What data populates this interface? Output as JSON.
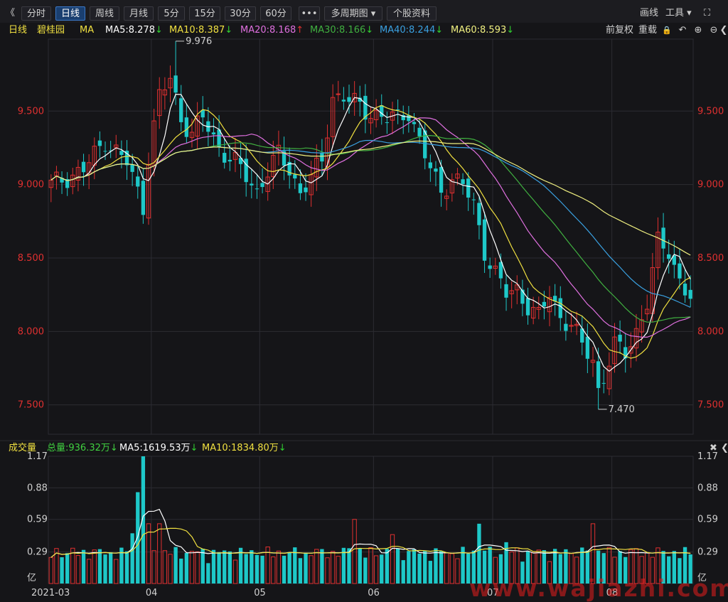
{
  "toolbar": {
    "collapse_icon": "double-chevron-left-icon",
    "collapse_glyph": "《",
    "buttons": [
      {
        "label": "分时",
        "active": false
      },
      {
        "label": "日线",
        "active": true
      },
      {
        "label": "周线",
        "active": false
      },
      {
        "label": "月线",
        "active": false
      },
      {
        "label": "5分",
        "active": false
      },
      {
        "label": "15分",
        "active": false
      },
      {
        "label": "30分",
        "active": false
      },
      {
        "label": "60分",
        "active": false
      }
    ],
    "more_label": "•••",
    "multi_period_label": "多周期图 ▾",
    "stock_info_label": "个股资料",
    "draw_label": "画线",
    "tools_label": "工具 ▾",
    "fullscreen_glyph": "⛶"
  },
  "legend": {
    "period": "日线",
    "stock_name": "碧桂园",
    "indicator": "MA",
    "items": [
      {
        "text": "MA5:8.278",
        "arrow": "↓",
        "color": "#ffffff"
      },
      {
        "text": "MA10:8.387",
        "arrow": "↓",
        "color": "#f0e040"
      },
      {
        "text": "MA20:8.168",
        "arrow": "↑",
        "color": "#e070e0"
      },
      {
        "text": "MA30:8.166",
        "arrow": "↓",
        "color": "#40b040"
      },
      {
        "text": "MA40:8.244",
        "arrow": "↓",
        "color": "#3aa0e0"
      },
      {
        "text": "MA60:8.593",
        "arrow": "↓",
        "color": "#f0f080"
      }
    ],
    "adjust_label": "前复权",
    "reload_label": "重载",
    "lock_glyph": "🔒",
    "undo_glyph": "↶",
    "zoom_in_glyph": "⊕",
    "zoom_out_glyph": "⊖",
    "expand_glyph": "❮"
  },
  "colors": {
    "up": "#e03030",
    "down": "#1ec8c8",
    "grid": "#2c2c32",
    "price_axis": "#e03030",
    "bg": "#151518"
  },
  "price_axis": {
    "ticks": [
      "9.500",
      "9.000",
      "8.500",
      "8.000",
      "7.500"
    ],
    "values": [
      9.5,
      9.0,
      8.5,
      8.0,
      7.5
    ],
    "max_label": "9.976",
    "min_label": "7.470"
  },
  "volume": {
    "title": "成交量",
    "total_label": "总量:936.32万",
    "total_arrow": "↓",
    "ma5_label": "MA5:1619.53万",
    "ma5_arrow": "↓",
    "ma10_label": "MA10:1834.80万",
    "ma10_arrow": "↓",
    "axis_ticks": [
      "1.17",
      "0.88",
      "0.59",
      "0.29",
      "亿"
    ],
    "close_glyph": "✖",
    "expand_glyph": "❮"
  },
  "x_axis": {
    "labels": [
      "2021-03",
      "04",
      "05",
      "06",
      "07",
      "08"
    ]
  },
  "watermark": "www.wajiazhi.com",
  "chart_data": {
    "type": "candlestick",
    "start_index_label": "2021-03",
    "month_starts": [
      {
        "label": "04",
        "index": 19
      },
      {
        "label": "05",
        "index": 39
      },
      {
        "label": "06",
        "index": 60
      },
      {
        "label": "07",
        "index": 82
      },
      {
        "label": "08",
        "index": 104
      }
    ],
    "close_anchors": [
      [
        0,
        9.0
      ],
      [
        6,
        9.1
      ],
      [
        10,
        9.3
      ],
      [
        14,
        9.15
      ],
      [
        17,
        8.85
      ],
      [
        18,
        9.2
      ],
      [
        20,
        9.6
      ],
      [
        22,
        9.72
      ],
      [
        24,
        9.45
      ],
      [
        26,
        9.35
      ],
      [
        28,
        9.45
      ],
      [
        31,
        9.25
      ],
      [
        34,
        9.15
      ],
      [
        36,
        9.05
      ],
      [
        38,
        8.95
      ],
      [
        40,
        9.1
      ],
      [
        42,
        9.2
      ],
      [
        44,
        9.1
      ],
      [
        46,
        8.95
      ],
      [
        48,
        9.05
      ],
      [
        50,
        9.15
      ],
      [
        52,
        9.6
      ],
      [
        54,
        9.6
      ],
      [
        56,
        9.55
      ],
      [
        58,
        9.5
      ],
      [
        60,
        9.48
      ],
      [
        62,
        9.45
      ],
      [
        64,
        9.45
      ],
      [
        66,
        9.5
      ],
      [
        68,
        9.3
      ],
      [
        70,
        9.1
      ],
      [
        72,
        8.95
      ],
      [
        74,
        9.05
      ],
      [
        76,
        9.0
      ],
      [
        78,
        8.85
      ],
      [
        80,
        8.55
      ],
      [
        82,
        8.4
      ],
      [
        84,
        8.25
      ],
      [
        86,
        8.28
      ],
      [
        88,
        8.18
      ],
      [
        90,
        8.1
      ],
      [
        92,
        8.25
      ],
      [
        94,
        8.1
      ],
      [
        96,
        8.05
      ],
      [
        98,
        7.9
      ],
      [
        100,
        7.8
      ],
      [
        101,
        7.6
      ],
      [
        102,
        7.7
      ],
      [
        104,
        7.9
      ],
      [
        106,
        7.85
      ],
      [
        108,
        8.0
      ],
      [
        110,
        8.2
      ],
      [
        112,
        8.6
      ],
      [
        114,
        8.55
      ],
      [
        116,
        8.35
      ],
      [
        118,
        8.22
      ]
    ],
    "candle_count": 119,
    "high_point": {
      "index": 23,
      "price": 9.976
    },
    "low_point": {
      "index": 101,
      "price": 7.47
    },
    "ma_last": {
      "MA5": 8.278,
      "MA10": 8.387,
      "MA20": 8.168,
      "MA30": 8.166,
      "MA40": 8.244,
      "MA60": 8.593
    },
    "price_range": [
      7.3,
      9.99
    ],
    "volume_range_yi": [
      0,
      1.17
    ],
    "volume_spikes": [
      [
        16,
        0.84
      ],
      [
        17,
        1.17
      ],
      [
        18,
        0.55
      ],
      [
        20,
        0.55
      ],
      [
        56,
        0.59
      ],
      [
        63,
        0.45
      ],
      [
        79,
        0.55
      ],
      [
        84,
        0.38
      ],
      [
        100,
        0.55
      ]
    ],
    "volume_base_yi": 0.18
  }
}
